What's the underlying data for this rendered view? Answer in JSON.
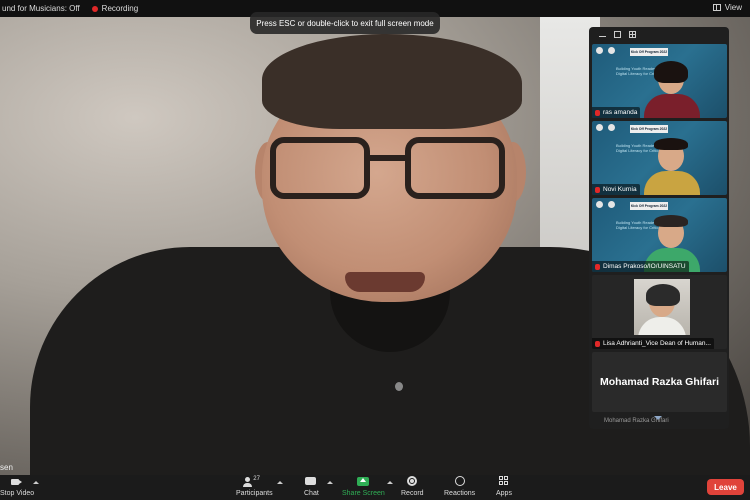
{
  "top_bar": {
    "original_sound_label": "und for Musicians: Off",
    "recording_label": "Recording",
    "view_label": "View"
  },
  "banner": {
    "text": "Press ESC or double-click to exit full screen mode"
  },
  "main_speaker": {
    "name_partial": "sen"
  },
  "gallery": {
    "slide_banner": "Kick Off Program 2022",
    "slide_text": "Building Youth Readership Expansion in Digital Literacy for Critical Year",
    "participants": [
      {
        "name": "ras amanda",
        "muted": true
      },
      {
        "name": "Novi Kurnia",
        "muted": true
      },
      {
        "name": "Dimas Prakoso/IO/UINSATU",
        "muted": true
      },
      {
        "name": "Lisa Adhrianti_Vice Dean of Human...",
        "muted": true
      }
    ],
    "name_card": "Mohamad Razka Ghifari",
    "next_name_partial": "Mohamad Razka Ghifari"
  },
  "toolbar": {
    "stop_video": "Stop Video",
    "participants": "Participants",
    "participants_count": "27",
    "chat": "Chat",
    "share_screen": "Share Screen",
    "record": "Record",
    "reactions": "Reactions",
    "apps": "Apps",
    "leave": "Leave"
  },
  "colors": {
    "leave_bg": "#e0433a",
    "share_green": "#2fae55",
    "recording_red": "#e02828",
    "slide_teal": "#2a7090"
  }
}
